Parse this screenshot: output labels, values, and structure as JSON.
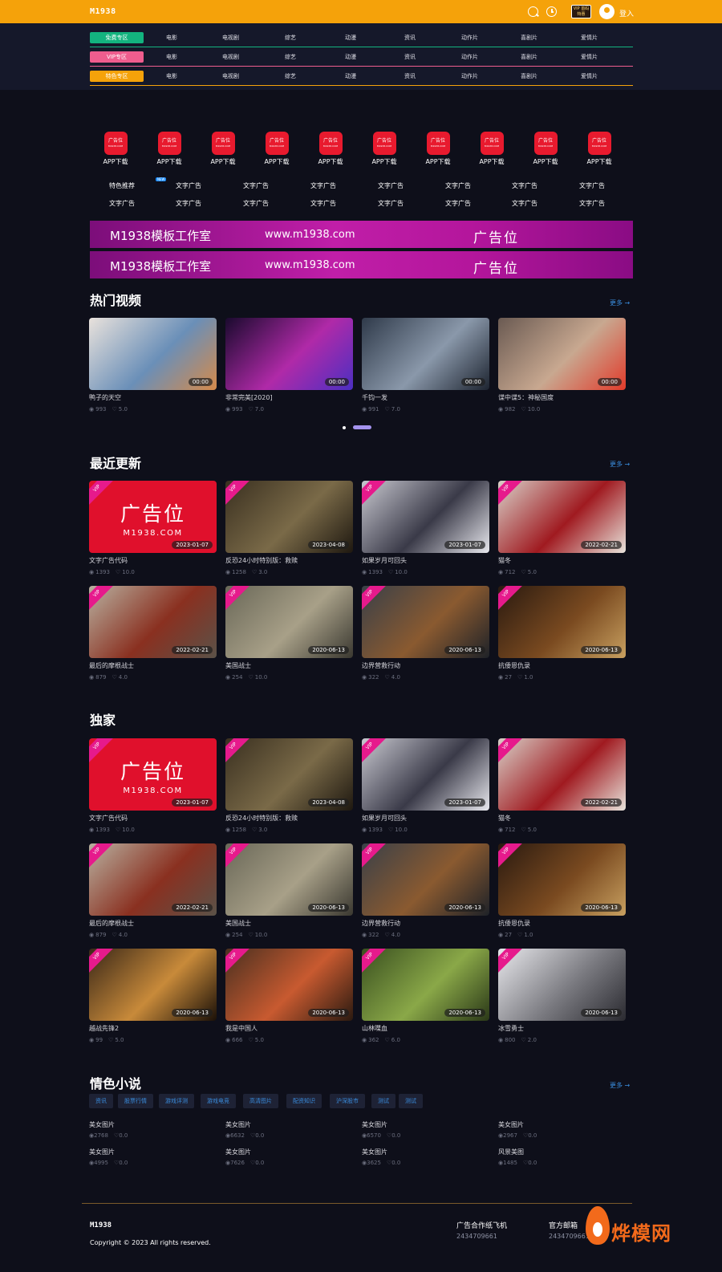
{
  "header": {
    "logo": "M1938",
    "vip_badge": "VIP 首码特惠",
    "login": "登入",
    "bg_color": "#f5a20a"
  },
  "nav": {
    "rows": [
      {
        "label": "免费专区",
        "color": "#13b37f",
        "links": [
          "电影",
          "电视剧",
          "综艺",
          "动漫",
          "资讯",
          "动作片",
          "喜剧片",
          "爱情片"
        ]
      },
      {
        "label": "VIP专区",
        "color": "#ef5d8e",
        "links": [
          "电影",
          "电视剧",
          "综艺",
          "动漫",
          "资讯",
          "动作片",
          "喜剧片",
          "爱情片"
        ]
      },
      {
        "label": "特色专区",
        "color": "#f5a20a",
        "links": [
          "电影",
          "电视剧",
          "综艺",
          "动漫",
          "资讯",
          "动作片",
          "喜剧片",
          "爱情片"
        ]
      }
    ]
  },
  "apps": {
    "box_text": "广告位",
    "box_sub": "M1938.COM",
    "label": "APP下载",
    "count": 10
  },
  "text_ads": {
    "row1": [
      "特色推荐",
      "文字广告",
      "文字广告",
      "文字广告",
      "文字广告",
      "文字广告",
      "文字广告",
      "文字广告"
    ],
    "row2": [
      "文字广告",
      "文字广告",
      "文字广告",
      "文字广告",
      "文字广告",
      "文字广告",
      "文字广告",
      "文字广告"
    ],
    "new_tag": "NEW"
  },
  "banners": [
    {
      "studio": "M1938模板工作室",
      "url": "www.m1938.com",
      "ad": "广告位"
    },
    {
      "studio": "M1938模板工作室",
      "url": "www.m1938.com",
      "ad": "广告位"
    }
  ],
  "hot": {
    "title": "热门视频",
    "more": "更多 →",
    "items": [
      {
        "title": "鸭子的天空",
        "views": "993",
        "rating": "5.0",
        "badge": "00:00",
        "colors": [
          "#e9e2dc",
          "#6a8fb8",
          "#d58a4a"
        ]
      },
      {
        "title": "非常完美[2020]",
        "views": "993",
        "rating": "7.0",
        "badge": "00:00",
        "colors": [
          "#1a0a2e",
          "#b02aa8",
          "#4b2fc2"
        ]
      },
      {
        "title": "千钧一发",
        "views": "991",
        "rating": "7.0",
        "badge": "00:00",
        "colors": [
          "#2f3a4a",
          "#8a98aa",
          "#1d2430"
        ]
      },
      {
        "title": "谍中谍5：神秘国度",
        "views": "982",
        "rating": "10.0",
        "badge": "00:00",
        "colors": [
          "#6a5a52",
          "#c8a890",
          "#e23a2a"
        ]
      }
    ]
  },
  "recent": {
    "title": "最近更新",
    "more": "更多 →",
    "items": [
      {
        "title": "文字广告代码",
        "views": "1393",
        "rating": "10.0",
        "badge": "2023-01-07",
        "ad": true
      },
      {
        "title": "反恐24小时特别版：救赎",
        "views": "1258",
        "rating": "3.0",
        "badge": "2023-04-08",
        "colors": [
          "#3a3020",
          "#7a6a48",
          "#1e1810"
        ]
      },
      {
        "title": "如果岁月可回头",
        "views": "1393",
        "rating": "10.0",
        "badge": "2023-01-07",
        "colors": [
          "#c8c8d0",
          "#3a3a48",
          "#e8e8ee"
        ]
      },
      {
        "title": "猫冬",
        "views": "712",
        "rating": "5.0",
        "badge": "2022-02-21",
        "colors": [
          "#d8d0c8",
          "#a01a20",
          "#e8e4dc"
        ]
      },
      {
        "title": "最后的摩根战士",
        "views": "879",
        "rating": "4.0",
        "badge": "2022-02-21",
        "colors": [
          "#b8b0a0",
          "#8a3020",
          "#5a5248"
        ]
      },
      {
        "title": "美国战士",
        "views": "254",
        "rating": "10.0",
        "badge": "2020-06-13",
        "colors": [
          "#6a6858",
          "#a8a088",
          "#3a3830"
        ]
      },
      {
        "title": "边界营救行动",
        "views": "322",
        "rating": "4.0",
        "badge": "2020-06-13",
        "colors": [
          "#3a4048",
          "#8a5a30",
          "#1e2228"
        ]
      },
      {
        "title": "抗倭恩仇录",
        "views": "27",
        "rating": "1.0",
        "badge": "2020-06-13",
        "colors": [
          "#2a1a10",
          "#7a4a20",
          "#c8a060"
        ]
      }
    ]
  },
  "exclusive": {
    "title": "独家",
    "items": [
      {
        "title": "文字广告代码",
        "views": "1393",
        "rating": "10.0",
        "badge": "2023-01-07",
        "ad": true
      },
      {
        "title": "反恐24小时特别版：救赎",
        "views": "1258",
        "rating": "3.0",
        "badge": "2023-04-08",
        "colors": [
          "#3a3020",
          "#7a6a48",
          "#1e1810"
        ]
      },
      {
        "title": "如果岁月可回头",
        "views": "1393",
        "rating": "10.0",
        "badge": "2023-01-07",
        "colors": [
          "#c8c8d0",
          "#3a3a48",
          "#e8e8ee"
        ]
      },
      {
        "title": "猫冬",
        "views": "712",
        "rating": "5.0",
        "badge": "2022-02-21",
        "colors": [
          "#d8d0c8",
          "#a01a20",
          "#e8e4dc"
        ]
      },
      {
        "title": "最后的摩根战士",
        "views": "879",
        "rating": "4.0",
        "badge": "2022-02-21",
        "colors": [
          "#b8b0a0",
          "#8a3020",
          "#5a5248"
        ]
      },
      {
        "title": "美国战士",
        "views": "254",
        "rating": "10.0",
        "badge": "2020-06-13",
        "colors": [
          "#6a6858",
          "#a8a088",
          "#3a3830"
        ]
      },
      {
        "title": "边界营救行动",
        "views": "322",
        "rating": "4.0",
        "badge": "2020-06-13",
        "colors": [
          "#3a4048",
          "#8a5a30",
          "#1e2228"
        ]
      },
      {
        "title": "抗倭恩仇录",
        "views": "27",
        "rating": "1.0",
        "badge": "2020-06-13",
        "colors": [
          "#2a1a10",
          "#7a4a20",
          "#c8a060"
        ]
      },
      {
        "title": "越战先锋2",
        "views": "99",
        "rating": "5.0",
        "badge": "2020-06-13",
        "colors": [
          "#3a2818",
          "#c88a3a",
          "#1a1008"
        ]
      },
      {
        "title": "我是中国人",
        "views": "666",
        "rating": "5.0",
        "badge": "2020-06-13",
        "colors": [
          "#4a3020",
          "#c85a30",
          "#2a1a10"
        ]
      },
      {
        "title": "山林喋血",
        "views": "362",
        "rating": "6.0",
        "badge": "2020-06-13",
        "colors": [
          "#3a5020",
          "#8aa848",
          "#2a3818"
        ]
      },
      {
        "title": "冰雪勇士",
        "views": "800",
        "rating": "2.0",
        "badge": "2020-06-13",
        "colors": [
          "#e8e8ec",
          "#7a7a80",
          "#2a2a30"
        ]
      }
    ]
  },
  "novels": {
    "title": "情色小说",
    "more": "更多 →",
    "tags": [
      "资讯",
      "股票行情",
      "游戏评测",
      "游戏电竞",
      "高清图片",
      "配资知识",
      "沪深股市",
      "测试",
      "测试"
    ],
    "items": [
      {
        "title": "美女图片",
        "views": "2768",
        "rating": "0.0"
      },
      {
        "title": "美女图片",
        "views": "6632",
        "rating": "0.0"
      },
      {
        "title": "美女图片",
        "views": "6570",
        "rating": "0.0"
      },
      {
        "title": "美女图片",
        "views": "2967",
        "rating": "0.0"
      },
      {
        "title": "美女图片",
        "views": "4995",
        "rating": "0.0"
      },
      {
        "title": "美女图片",
        "views": "7626",
        "rating": "0.0"
      },
      {
        "title": "美女图片",
        "views": "3625",
        "rating": "0.0"
      },
      {
        "title": "风景美图",
        "views": "1485",
        "rating": "0.0"
      }
    ]
  },
  "ad_thumb": {
    "line1": "广告位",
    "line2": "M1938.COM",
    "vip": "VIP"
  },
  "footer": {
    "logo": "M1938",
    "copyright": "Copyright © 2023 All rights reserved.",
    "col1_title": "广告合作纸飞机",
    "col1_value": "2434709661",
    "col2_title": "官方邮箱",
    "col2_value": "2434709661@qq.com",
    "watermark": "烨模网"
  }
}
